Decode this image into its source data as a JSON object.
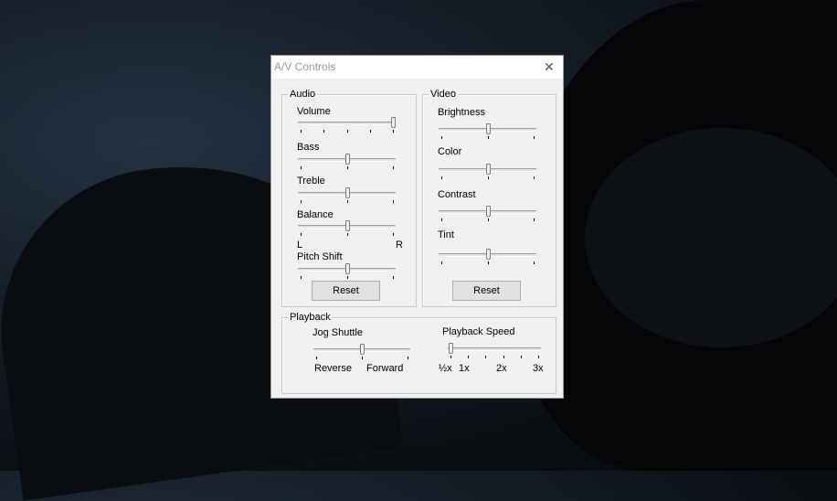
{
  "window": {
    "title": "A/V Controls",
    "close_glyph": "✕"
  },
  "audio": {
    "legend": "Audio",
    "volume_label": "Volume",
    "volume_level": 1.0,
    "bass_label": "Bass",
    "bass_level": 0.5,
    "treble_label": "Treble",
    "treble_level": 0.5,
    "balance_label": "Balance",
    "balance_level": 0.5,
    "balance_left": "L",
    "balance_right": "R",
    "pitch_label": "Pitch Shift",
    "pitch_level": 0.5,
    "reset_label": "Reset"
  },
  "video": {
    "legend": "Video",
    "brightness_label": "Brightness",
    "brightness_level": 0.5,
    "color_label": "Color",
    "color_level": 0.5,
    "contrast_label": "Contrast",
    "contrast_level": 0.5,
    "tint_label": "Tint",
    "tint_level": 0.5,
    "reset_label": "Reset"
  },
  "playback": {
    "legend": "Playback",
    "jog_label": "Jog Shuttle",
    "jog_level": 0.5,
    "reverse_label": "Reverse",
    "forward_label": "Forward",
    "speed_label": "Playback Speed",
    "speed_level": 0.0,
    "speed_marks": [
      "½x",
      "1x",
      "2x",
      "3x"
    ]
  }
}
